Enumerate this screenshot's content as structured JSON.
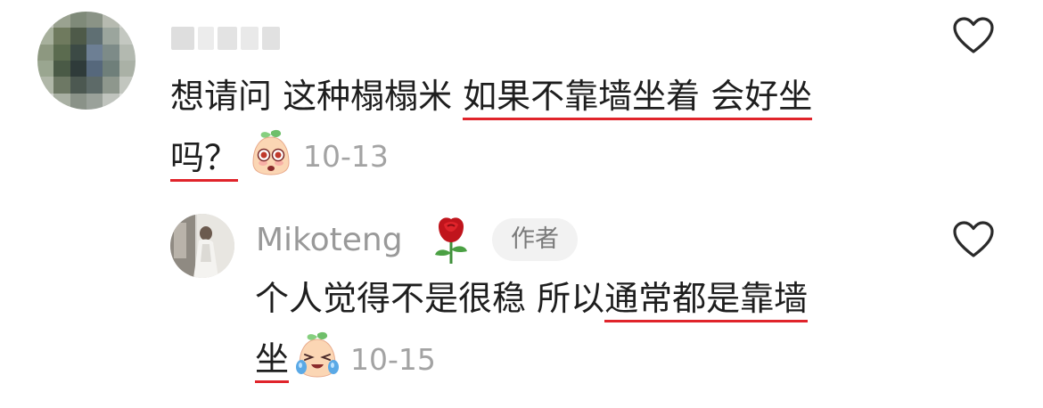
{
  "comments": [
    {
      "text_line1_plain": "想请问 这种榻榻米 ",
      "text_line1_underlined": "如果不靠墙坐着 会好坐",
      "text_line2_underlined": "吗？",
      "date": "10-13",
      "emoji_icon": "pleading-face-emoji-icon"
    }
  ],
  "reply": {
    "username": "Mikoteng",
    "flair_icon": "rose-icon",
    "author_badge": "作者",
    "text_line1_plain": "个人觉得不是很稳 所以",
    "text_line1_underlined": "通常都是靠墙",
    "text_line2_underlined": "坐",
    "date": "10-15",
    "emoji_icon": "crying-face-emoji-icon"
  },
  "colors": {
    "underline": "#e0242b",
    "meta_gray": "#a3a3a3",
    "text": "#1e1e1e",
    "badge_bg": "#f2f2f2"
  }
}
